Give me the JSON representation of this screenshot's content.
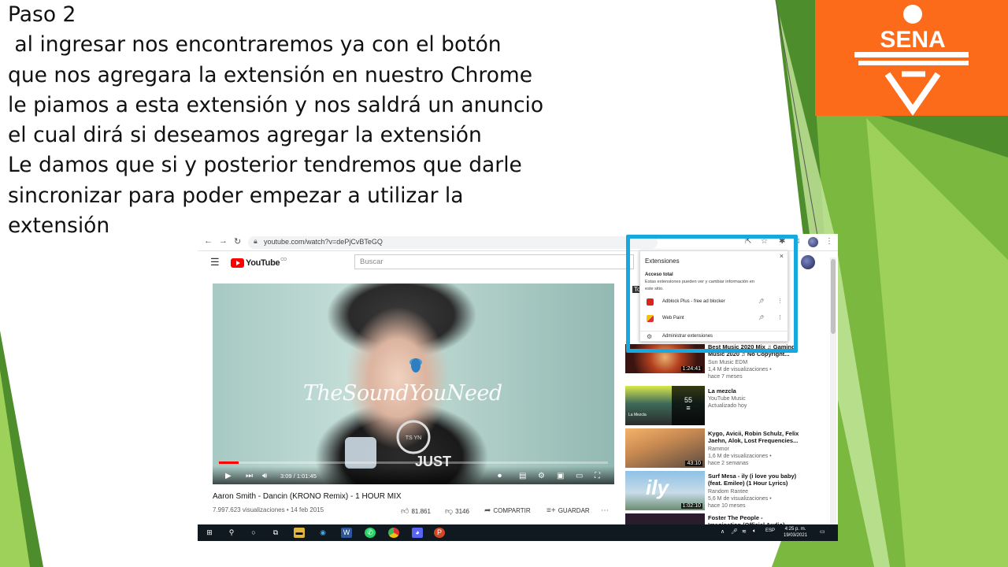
{
  "slide": {
    "lines": [
      "Paso 2",
      " al ingresar nos encontraremos ya con el botón",
      "que nos agregara la extensión en nuestro Chrome",
      "le piamos a esta extensión y nos saldrá un anuncio",
      "el cual dirá si deseamos agregar la extensión",
      "Le damos que si y posterior tendremos que darle",
      "sincronizar para poder empezar a utilizar la",
      "extensión"
    ],
    "logo_text": "SENA",
    "colors": {
      "logo_bg": "#fc6b1a",
      "green_dark": "#4e8d2c",
      "green_light": "#9ed15a",
      "highlight": "#17a8e0"
    }
  },
  "browser": {
    "url": "youtube.com/watch?v=dePjCvBTeGQ",
    "icons": [
      "back-icon",
      "forward-icon",
      "reload-icon",
      "lock-icon",
      "share-icon",
      "star-icon",
      "extensions-icon",
      "profile-avatar",
      "menu-dots-icon"
    ]
  },
  "youtube": {
    "logo_word": "YouTube",
    "logo_region": "CO",
    "search_placeholder": "Buscar",
    "video": {
      "watermark": "TheSoundYouNeed",
      "progress_fraction": 0.05,
      "time": "3:09 / 1:01:45",
      "title": "Aaron Smith - Dancin (KRONO Remix) - 1 HOUR MIX",
      "meta": "7.997.623 visualizaciones • 14 feb 2015",
      "likes": "81.861",
      "dislikes": "3146",
      "share_label": "COMPARTIR",
      "save_label": "GUARDAR"
    },
    "sidebar": [
      {
        "title_line1": "Best Music 2020 Mix ♫ Gaming",
        "title_line2": "Music 2020 ♫ No Copyright...",
        "channel": "Sun Music EDM",
        "views": "1,4 M de visualizaciones •",
        "age": "hace 7 meses",
        "duration": "1:24:41"
      },
      {
        "title_line1": "La mezcla",
        "title_line2": "",
        "channel": "YouTube Music",
        "views": "Actualizado hoy",
        "age": "",
        "count": "55",
        "thumb_label": "La Mezcla"
      },
      {
        "title_line1": "Kygo, Avicii, Robin Schulz, Felix",
        "title_line2": "Jaehn, Alok, Lost Frequencies...",
        "channel": "Rammor",
        "views": "1,6 M de visualizaciones •",
        "age": "hace 2 semanas",
        "duration": "43:10"
      },
      {
        "title_line1": "Surf Mesa - ily (i love you baby)",
        "title_line2": "(feat. Emilee) (1 Hour Lyrics)",
        "channel": "Random Rantee",
        "views": "5,6 M de visualizaciones •",
        "age": "hace 10 meses",
        "duration": "1:02:10",
        "thumb_label": "ily"
      },
      {
        "title_line1": "Foster The People -",
        "title_line2": "Imagination (Official Audio)",
        "channel": "",
        "views": "",
        "age": ""
      }
    ]
  },
  "extensions_popup": {
    "title": "Extensiones",
    "close": "×",
    "access_heading": "Acceso total",
    "access_desc": "Estas extensiones pueden ver y cambiar información en este sitio.",
    "items": [
      {
        "name": "Adblock Plus - free ad blocker"
      },
      {
        "name": "Web Paint"
      }
    ],
    "manage_label": "Administrar extensiones",
    "partial_text": "To"
  },
  "taskbar": {
    "lang": "ESP",
    "time": "4:25 p. m.",
    "date": "19/03/2021"
  }
}
